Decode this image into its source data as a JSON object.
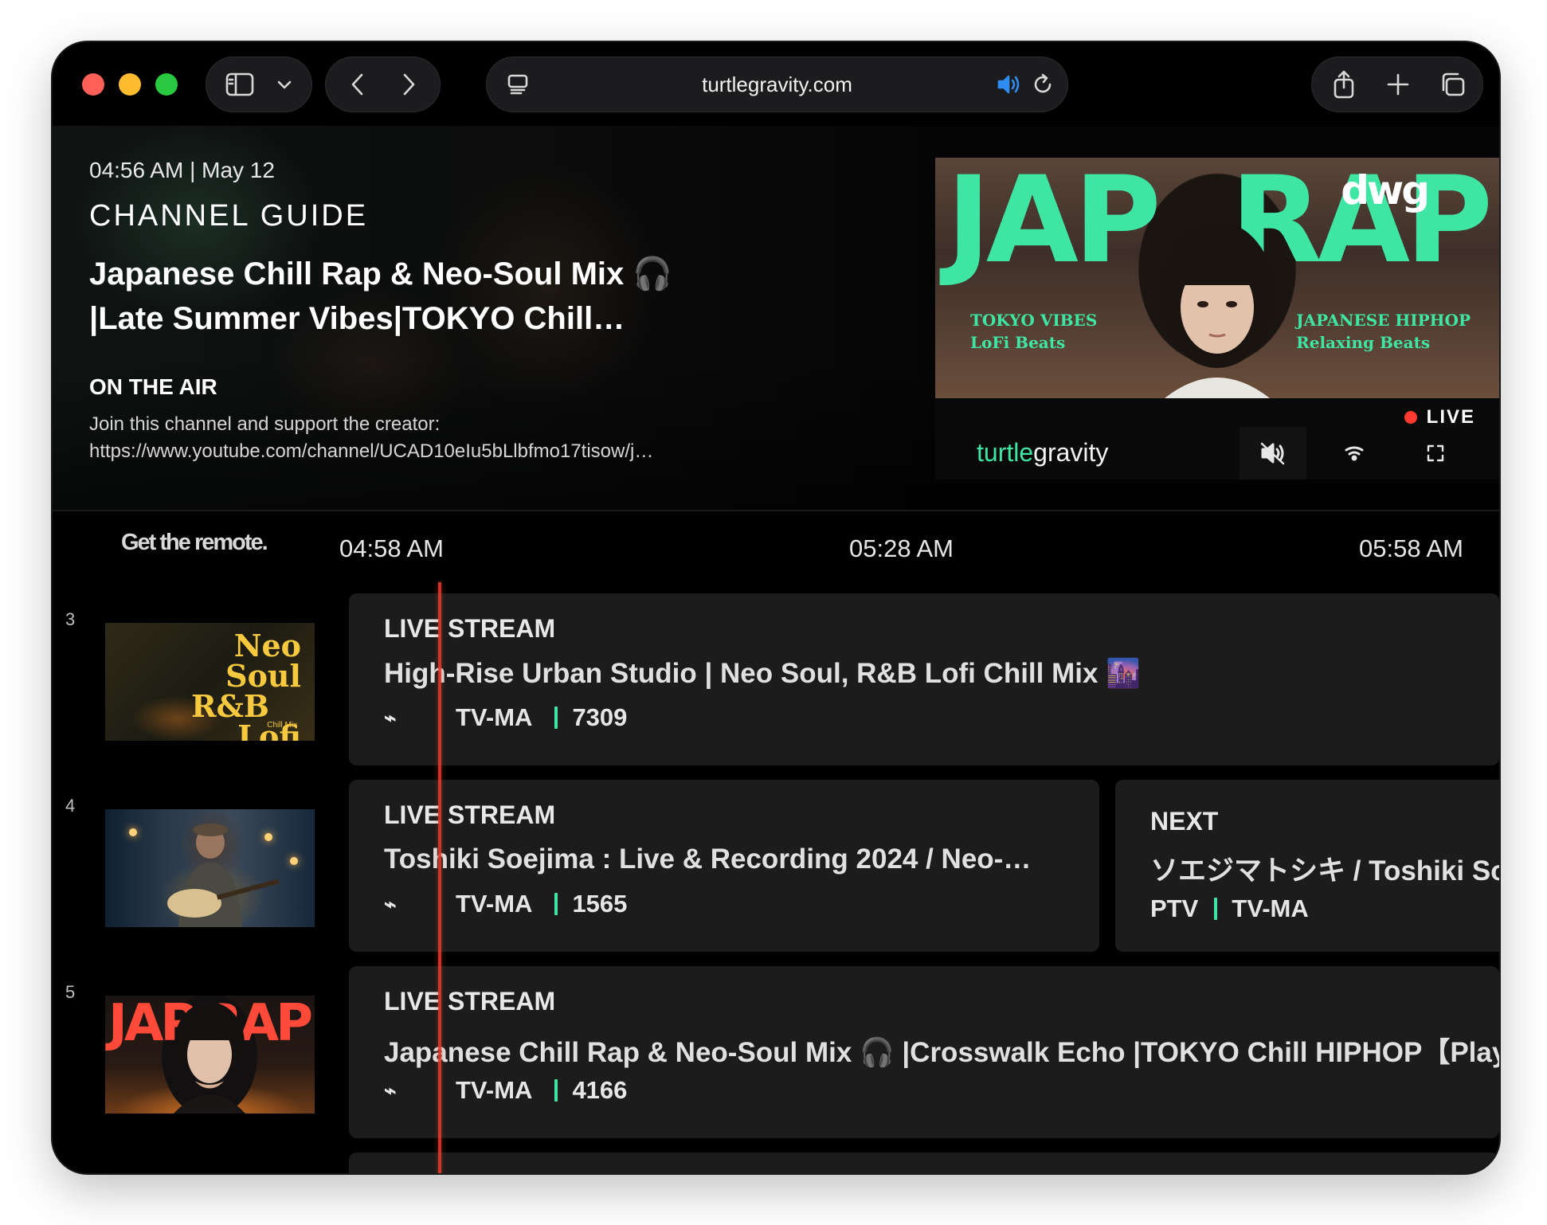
{
  "browser": {
    "url": "turtlegravity.com",
    "icons": [
      "sidebar-icon",
      "chevron-down-icon",
      "back-icon",
      "forward-icon",
      "page-menu-icon",
      "speaker-icon",
      "reload-icon",
      "share-icon",
      "plus-icon",
      "tabs-icon"
    ]
  },
  "hero": {
    "datetime": "04:56 AM | May 12",
    "guide_title": "CHANNEL GUIDE",
    "show_title": "Japanese Chill Rap & Neo-Soul Mix 🎧 |Late Summer Vibes|TOKYO Chill…",
    "on_air": "ON THE AIR",
    "desc_line1": "Join this channel and support the creator:",
    "desc_line2": "https://www.youtube.com/channel/UCAD10eIu5bLlbfmo17tisow/j…"
  },
  "player": {
    "video_text_left": "JAP",
    "video_text_right": "RAP",
    "video_logo": "dwg",
    "video_tag_left_1": "TOKYO VIBES",
    "video_tag_left_2": "LoFi Beats",
    "video_tag_right_1": "JAPANESE HIPHOP",
    "video_tag_right_2": "Relaxing Beats",
    "live_label": "LIVE",
    "brand_part1": "turtle",
    "brand_part2": "gravity"
  },
  "schedule": {
    "remote_label": "Get the remote.",
    "times": [
      "04:58 AM",
      "05:28 AM",
      "05:58 AM"
    ],
    "rows": [
      {
        "number": "3",
        "thumb_text": [
          "Neo Soul",
          "R&B",
          "Lofi"
        ],
        "thumb_small": "Chill Mix",
        "kicker": "LIVE STREAM",
        "title": "High-Rise Urban Studio | Neo Soul, R&B Lofi Chill Mix 🌆",
        "rating": "TV-MA",
        "viewers": "7309"
      },
      {
        "number": "4",
        "kicker": "LIVE STREAM",
        "title": "Toshiki Soejima : Live & Recording 2024 / Neo-…",
        "rating": "TV-MA",
        "viewers": "1565",
        "next": {
          "kicker": "NEXT",
          "title": "ソエジマトシキ / Toshiki Soejima",
          "rating_a": "PTV",
          "rating_b": "TV-MA"
        }
      },
      {
        "number": "5",
        "thumb_text": [
          "JAP",
          "RAP"
        ],
        "kicker": "LIVE STREAM",
        "title": "Japanese Chill Rap & Neo-Soul Mix 🎧 |Crosswalk Echo |TOKYO Chill HIPHOP【Playlist】",
        "rating": "TV-MA",
        "viewers": "4166"
      }
    ]
  },
  "colors": {
    "accent": "#3fe6a3",
    "live_red": "#ff3b30",
    "playhead": "#e0392b",
    "card_bg": "#1c1c1c"
  }
}
